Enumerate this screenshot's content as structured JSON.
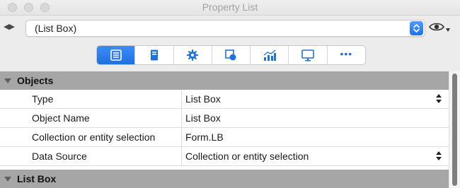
{
  "window": {
    "title": "Property List"
  },
  "selector": {
    "value": "(List Box)"
  },
  "toolbar": {
    "tabs": [
      {
        "icon": "list-icon",
        "active": true
      },
      {
        "icon": "form-icon",
        "active": false
      },
      {
        "icon": "gear-icon",
        "active": false
      },
      {
        "icon": "shape-icon",
        "active": false
      },
      {
        "icon": "chart-icon",
        "active": false
      },
      {
        "icon": "monitor-icon",
        "active": false
      },
      {
        "icon": "more-icon",
        "label": "•••",
        "active": false
      }
    ]
  },
  "sections": [
    {
      "label": "Objects",
      "rows": [
        {
          "name": "Type",
          "value": "List Box",
          "stepper": true
        },
        {
          "name": "Object Name",
          "value": "List Box",
          "stepper": false
        },
        {
          "name": "Collection or entity selection",
          "value": "Form.LB",
          "stepper": false
        },
        {
          "name": "Data Source",
          "value": "Collection or entity selection",
          "stepper": true
        }
      ]
    },
    {
      "label": "List Box",
      "rows": []
    }
  ],
  "colors": {
    "accent": "#1f6fe2",
    "section_header": "#a6a6a6"
  }
}
